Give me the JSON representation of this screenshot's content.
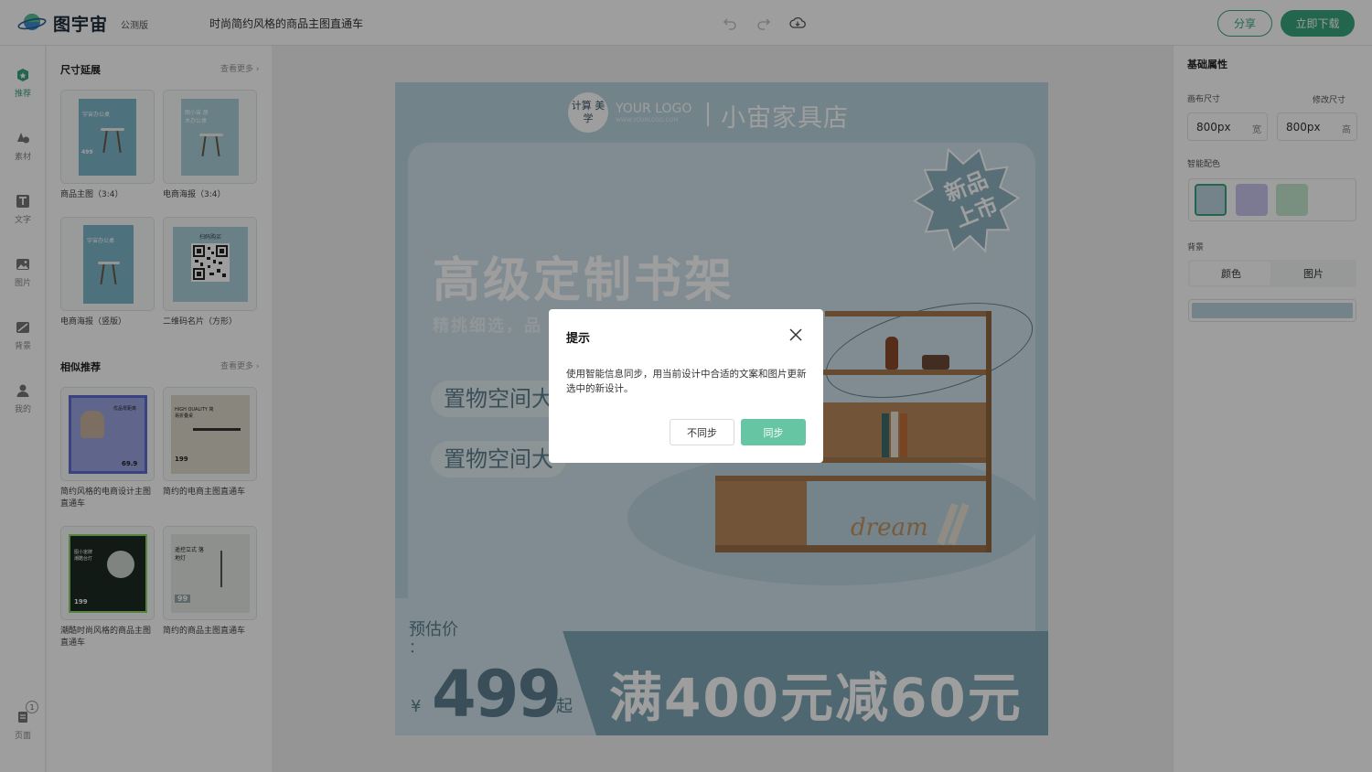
{
  "header": {
    "logo_text": "图宇宙",
    "beta_label": "公测版",
    "doc_title": "时尚简约风格的商品主图直通车",
    "share_label": "分享",
    "download_label": "立即下载",
    "icons": [
      "undo-icon",
      "redo-icon",
      "cloud-save-icon"
    ]
  },
  "leftnav": {
    "items": [
      {
        "label": "推荐",
        "icon": "recommend-icon",
        "active": true
      },
      {
        "label": "素材",
        "icon": "material-icon"
      },
      {
        "label": "文字",
        "icon": "text-icon"
      },
      {
        "label": "图片",
        "icon": "image-icon"
      },
      {
        "label": "背景",
        "icon": "background-icon"
      },
      {
        "label": "我的",
        "icon": "user-icon"
      }
    ],
    "pages_label": "页面",
    "pages_count": "1"
  },
  "size_section": {
    "title": "尺寸延展",
    "more": "查看更多",
    "items": [
      {
        "caption": "商品主图（3:4）",
        "thumb_text": "宇宙办公桌",
        "price": "499"
      },
      {
        "caption": "电商海报（3:4）",
        "thumb_text": "图小宙 原木办公桌",
        "price": ""
      },
      {
        "caption": "电商海报（竖版）",
        "thumb_text": "宇宙办公桌",
        "price": ""
      },
      {
        "caption": "二维码名片（方形）",
        "thumb_text": "扫码购买",
        "price": ""
      }
    ]
  },
  "similar_section": {
    "title": "相似推荐",
    "more": "查看更多",
    "items": [
      {
        "caption": "简约风格的电商设计主图直通车",
        "thumb_text": "优品零距离",
        "price": "69.9"
      },
      {
        "caption": "简约的电商主图直通车",
        "thumb_text": "HIGH QUALITY 简易折叠桌",
        "price": "199"
      },
      {
        "caption": "潮酷时尚风格的商品主图直通车",
        "thumb_text": "图小宙牌 潮酷台灯",
        "price": "199"
      },
      {
        "caption": "简约的商品主图直通车",
        "thumb_text": "遥控立式 落地灯",
        "price": "99"
      }
    ]
  },
  "poster": {
    "logo_cn": "计算 美学",
    "logo_en": "YOUR LOGO",
    "logo_url": "WWW.YOURLOGO.COM",
    "shop_name": "小宙家具店",
    "badge": "新品 上市",
    "headline": "高级定制书架",
    "sub_headline": "精挑细选，品",
    "tag1": "置物空间大",
    "tag2": "置物空间大",
    "shelf_word": "dream",
    "price_label": "预估价",
    "price_colon": "：",
    "currency": "¥",
    "price": "499",
    "price_suffix": "起",
    "promo": "满400元减60元"
  },
  "rightpanel": {
    "title": "基础属性",
    "canvas_size_label": "画布尺寸",
    "edit_size_label": "修改尺寸",
    "width_value": "800px",
    "width_unit": "宽",
    "height_value": "800px",
    "height_unit": "高",
    "smart_color_label": "智能配色",
    "swatches": [
      "#bcd4dd",
      "#c9c4ec",
      "#c3e7cd"
    ],
    "background_label": "背景",
    "bg_tab_color": "颜色",
    "bg_tab_image": "图片",
    "bg_color": "#bcd4dd"
  },
  "dialog": {
    "title": "提示",
    "message": "使用智能信息同步，用当前设计中合适的文案和图片更新选中的新设计。",
    "cancel_label": "不同步",
    "ok_label": "同步"
  }
}
